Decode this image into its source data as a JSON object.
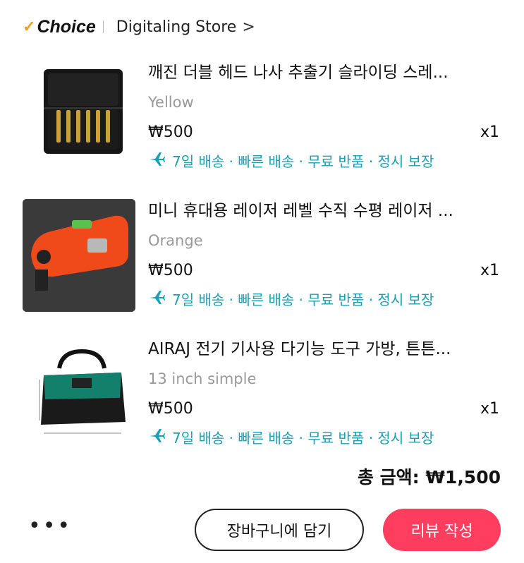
{
  "header": {
    "brand": "Choice",
    "store_name": "Digitaling Store",
    "chevron": ">"
  },
  "items": [
    {
      "title": "깨진 더블 헤드 나사 추출기 슬라이딩 스레...",
      "variant": "Yellow",
      "price": "₩500",
      "qty": "x1",
      "shipping": "7일 배송 · 빠른 배송 · 무료 반품 · 정시 보장",
      "image_icon": "screw-extractor-set-image"
    },
    {
      "title": "미니 휴대용 레이저 레벨 수직 수평 레이저 ...",
      "variant": "Orange",
      "price": "₩500",
      "qty": "x1",
      "shipping": "7일 배송 · 빠른 배송 · 무료 반품 · 정시 보장",
      "image_icon": "laser-level-image"
    },
    {
      "title": "AIRAJ 전기 기사용 다기능 도구 가방, 튼튼...",
      "variant": "13 inch simple",
      "price": "₩500",
      "qty": "x1",
      "shipping": "7일 배송 · 빠른 배송 · 무료 반품 · 정시 보장",
      "image_icon": "tool-bag-image"
    }
  ],
  "summary": {
    "total_label": "총 금액: ₩1,500"
  },
  "actions": {
    "more": "•••",
    "add_to_cart": "장바구니에 담기",
    "write_review": "리뷰 작성"
  },
  "colors": {
    "shipping": "#1aa0b4",
    "review_button": "#ff3d5e",
    "choice_check": "#f2a017"
  }
}
